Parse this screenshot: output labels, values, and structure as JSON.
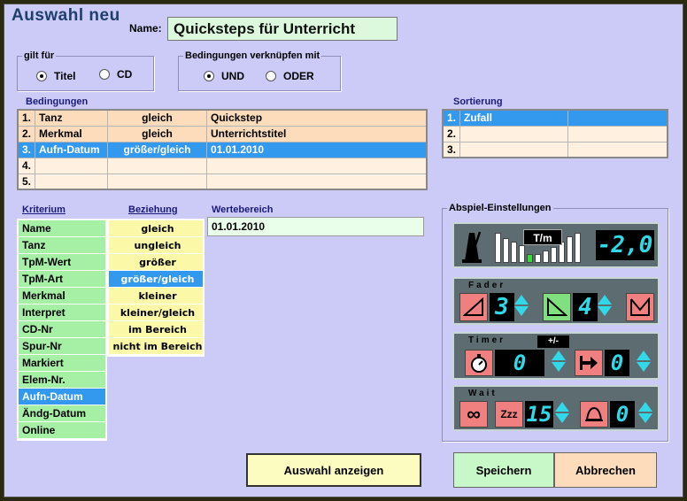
{
  "header": {
    "title": "Auswahl  neu",
    "name_label": "Name:",
    "name_value": "Quicksteps für Unterricht"
  },
  "gilt_fuer": {
    "legend": "gilt für",
    "options": [
      "Titel",
      "CD"
    ],
    "selected": "Titel"
  },
  "verknuepfen": {
    "legend": "Bedingungen verknüpfen mit",
    "options": [
      "UND",
      "ODER"
    ],
    "selected": "UND"
  },
  "bedingungen": {
    "label": "Bedingungen",
    "rows": [
      {
        "n": "1.",
        "feld": "Tanz",
        "op": "gleich",
        "wert": "Quickstep"
      },
      {
        "n": "2.",
        "feld": "Merkmal",
        "op": "gleich",
        "wert": "Unterrichtstitel"
      },
      {
        "n": "3.",
        "feld": "Aufn-Datum",
        "op": "größer/gleich",
        "wert": "01.01.2010"
      },
      {
        "n": "4.",
        "feld": "",
        "op": "",
        "wert": ""
      },
      {
        "n": "5.",
        "feld": "",
        "op": "",
        "wert": ""
      }
    ],
    "selected_row": 3
  },
  "sortierung": {
    "label": "Sortierung",
    "rows": [
      {
        "n": "1.",
        "v": "Zufall"
      },
      {
        "n": "2.",
        "v": ""
      },
      {
        "n": "3.",
        "v": ""
      }
    ]
  },
  "kriterium": {
    "label": "Kriterium",
    "items": [
      "Name",
      "Tanz",
      "TpM-Wert",
      "TpM-Art",
      "Merkmal",
      "Interpret",
      "CD-Nr",
      "Spur-Nr",
      "Markiert",
      "Elem-Nr.",
      "Aufn-Datum",
      "Ändg-Datum",
      "Online"
    ],
    "selected": "Aufn-Datum"
  },
  "beziehung": {
    "label": "Beziehung",
    "items": [
      "gleich",
      "ungleich",
      "größer",
      "größer/gleich",
      "kleiner",
      "kleiner/gleich",
      "im Bereich",
      "nicht im Bereich"
    ],
    "selected": "größer/gleich"
  },
  "wertebereich": {
    "label": "Wertebereich",
    "value": "01.01.2010"
  },
  "abspiel": {
    "label": "Abspiel-Einstellungen",
    "tempo": {
      "unit": "T/m",
      "value": "-2,0"
    },
    "fader": {
      "label": "Fader",
      "fade_in": "3",
      "fade_out": "4"
    },
    "timer": {
      "label": "Timer",
      "plusminus": "+/-",
      "start": "0",
      "stop": "0"
    },
    "wait": {
      "label": "Wait",
      "zzz": "Zzz",
      "sleep": "15",
      "bell": "0"
    }
  },
  "buttons": {
    "show": "Auswahl anzeigen",
    "save": "Speichern",
    "cancel": "Abbrechen"
  },
  "colors": {
    "background": "#cccaf7",
    "selection": "#3399ee",
    "list_green": "#a6f0a6",
    "list_yellow": "#fbf9a8",
    "row_peach": "#fcdcbb",
    "lcd_text": "#30d8e8"
  }
}
